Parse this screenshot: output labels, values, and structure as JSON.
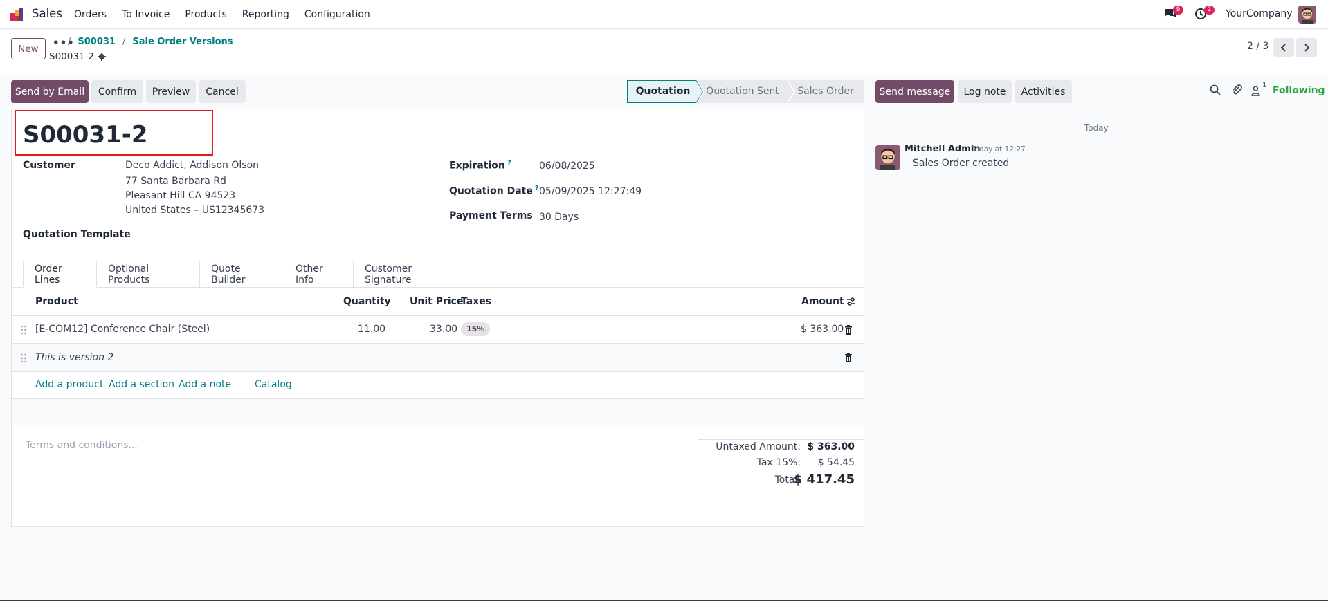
{
  "navbar": {
    "app_name": "Sales",
    "menu": [
      "Orders",
      "To Invoice",
      "Products",
      "Reporting",
      "Configuration"
    ],
    "messages_count": "9",
    "activities_count": "2",
    "company": "YourCompany"
  },
  "control": {
    "new_label": "New",
    "breadcrumb": {
      "dots": "•••",
      "items": [
        "S00031",
        "Sale Order Versions"
      ]
    },
    "record_name": "S00031-2",
    "pager": "2 / 3"
  },
  "actions": {
    "send_by_email": "Send by Email",
    "confirm": "Confirm",
    "preview": "Preview",
    "cancel": "Cancel"
  },
  "status": {
    "stages": [
      "Quotation",
      "Quotation Sent",
      "Sales Order"
    ],
    "active": "Quotation"
  },
  "form": {
    "title": "S00031-2",
    "customer_label": "Customer",
    "customer_lines": [
      "Deco Addict, Addison Olson",
      "77 Santa Barbara Rd",
      "Pleasant Hill CA 94523",
      "United States – US12345673"
    ],
    "template_label": "Quotation Template",
    "expiration_label": "Expiration",
    "expiration_value": "06/08/2025",
    "quotation_date_label": "Quotation Date",
    "quotation_date_value": "05/09/2025 12:27:49",
    "payment_terms_label": "Payment Terms",
    "payment_terms_value": "30 Days",
    "help_mark": "?"
  },
  "tabs": [
    "Order Lines",
    "Optional Products",
    "Quote Builder",
    "Other Info",
    "Customer Signature"
  ],
  "order_lines": {
    "headers": {
      "product": "Product",
      "quantity": "Quantity",
      "unit_price": "Unit Price",
      "taxes": "Taxes",
      "amount": "Amount"
    },
    "rows": [
      {
        "product": "[E-COM12] Conference Chair (Steel)",
        "quantity": "11.00",
        "unit_price": "33.00",
        "tax": "15%",
        "amount": "$ 363.00"
      }
    ],
    "note": "This is version 2",
    "add_links": [
      "Add a product",
      "Add a section",
      "Add a note",
      "Catalog"
    ]
  },
  "terms_placeholder": "Terms and conditions...",
  "totals": {
    "untaxed_label": "Untaxed Amount:",
    "untaxed_value": "$ 363.00",
    "tax_label": "Tax 15%:",
    "tax_value": "$ 54.45",
    "total_label": "Total:",
    "total_value": "$ 417.45"
  },
  "chatter": {
    "send_message": "Send message",
    "log_note": "Log note",
    "activities": "Activities",
    "followers_count": "1",
    "following": "Following",
    "date_separator": "Today",
    "message": {
      "author": "Mitchell Admin",
      "time": "Today at 12:27",
      "body": "Sales Order created"
    }
  },
  "colors": {
    "brand": "#714b67",
    "link": "#017e84",
    "badge": "#e0225a",
    "following": "#28a745",
    "highlight": "#e0171d"
  }
}
